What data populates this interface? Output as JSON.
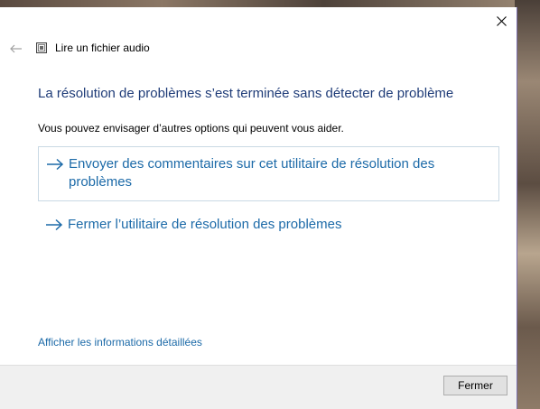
{
  "window": {
    "title": "Lire un fichier audio",
    "accent_color": "#7a6fae"
  },
  "icons": {
    "back": "back-arrow-icon",
    "close": "close-icon",
    "app": "audio-troubleshooter-icon",
    "option_arrow": "right-arrow-icon"
  },
  "main": {
    "heading": "La résolution de problèmes s’est terminée sans détecter de problème",
    "subtext": "Vous pouvez envisager d’autres options qui peuvent vous aider.",
    "options": [
      {
        "label": "Envoyer des commentaires sur cet utilitaire de résolution des problèmes"
      },
      {
        "label": "Fermer l’utilitaire de résolution des problèmes"
      }
    ],
    "details_link": "Afficher les informations détaillées"
  },
  "footer": {
    "close_label": "Fermer"
  },
  "colors": {
    "heading": "#1f3c78",
    "link": "#1c6aa8",
    "footer_bg": "#f0f0f0"
  }
}
